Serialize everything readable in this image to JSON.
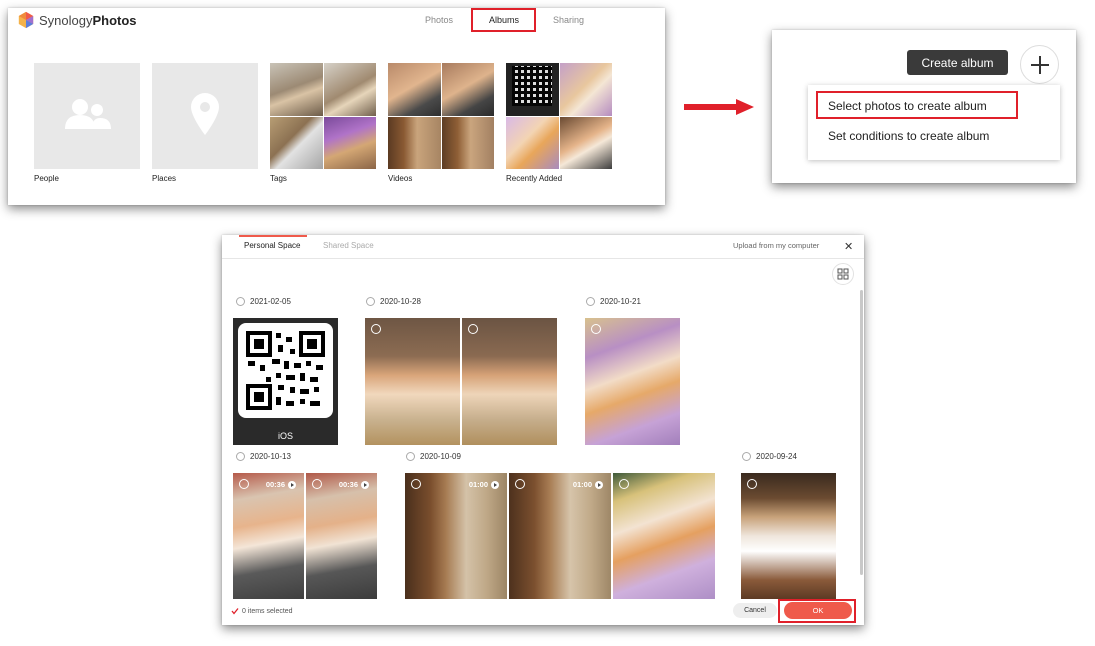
{
  "albums_panel": {
    "logo": {
      "brand": "Synology",
      "product": "Photos"
    },
    "nav": [
      {
        "label": "Photos"
      },
      {
        "label": "Albums"
      },
      {
        "label": "Sharing"
      }
    ],
    "tiles": [
      {
        "label": "People"
      },
      {
        "label": "Places"
      },
      {
        "label": "Tags"
      },
      {
        "label": "Videos"
      },
      {
        "label": "Recently Added"
      }
    ]
  },
  "create_panel": {
    "create_album_label": "Create album",
    "menu": [
      {
        "label": "Select photos to create album"
      },
      {
        "label": "Set conditions to create album"
      }
    ]
  },
  "picker": {
    "tabs": [
      {
        "label": "Personal Space"
      },
      {
        "label": "Shared Space"
      }
    ],
    "upload_label": "Upload from my computer",
    "groups": [
      {
        "date": "2021-02-05"
      },
      {
        "date": "2020-10-28"
      },
      {
        "date": "2020-10-21"
      },
      {
        "date": "2020-10-13"
      },
      {
        "date": "2020-10-09"
      },
      {
        "date": "2020-09-24"
      }
    ],
    "qr_caption": "iOS",
    "durations": [
      "00:36",
      "00:36",
      "01:00",
      "01:00"
    ],
    "footer": {
      "selected_text": "0 items selected",
      "cancel_label": "Cancel",
      "ok_label": "OK"
    }
  },
  "colors": {
    "highlight_red": "#e0202a",
    "ok_button": "#ef5a4b",
    "create_button": "#3a3a3a"
  }
}
